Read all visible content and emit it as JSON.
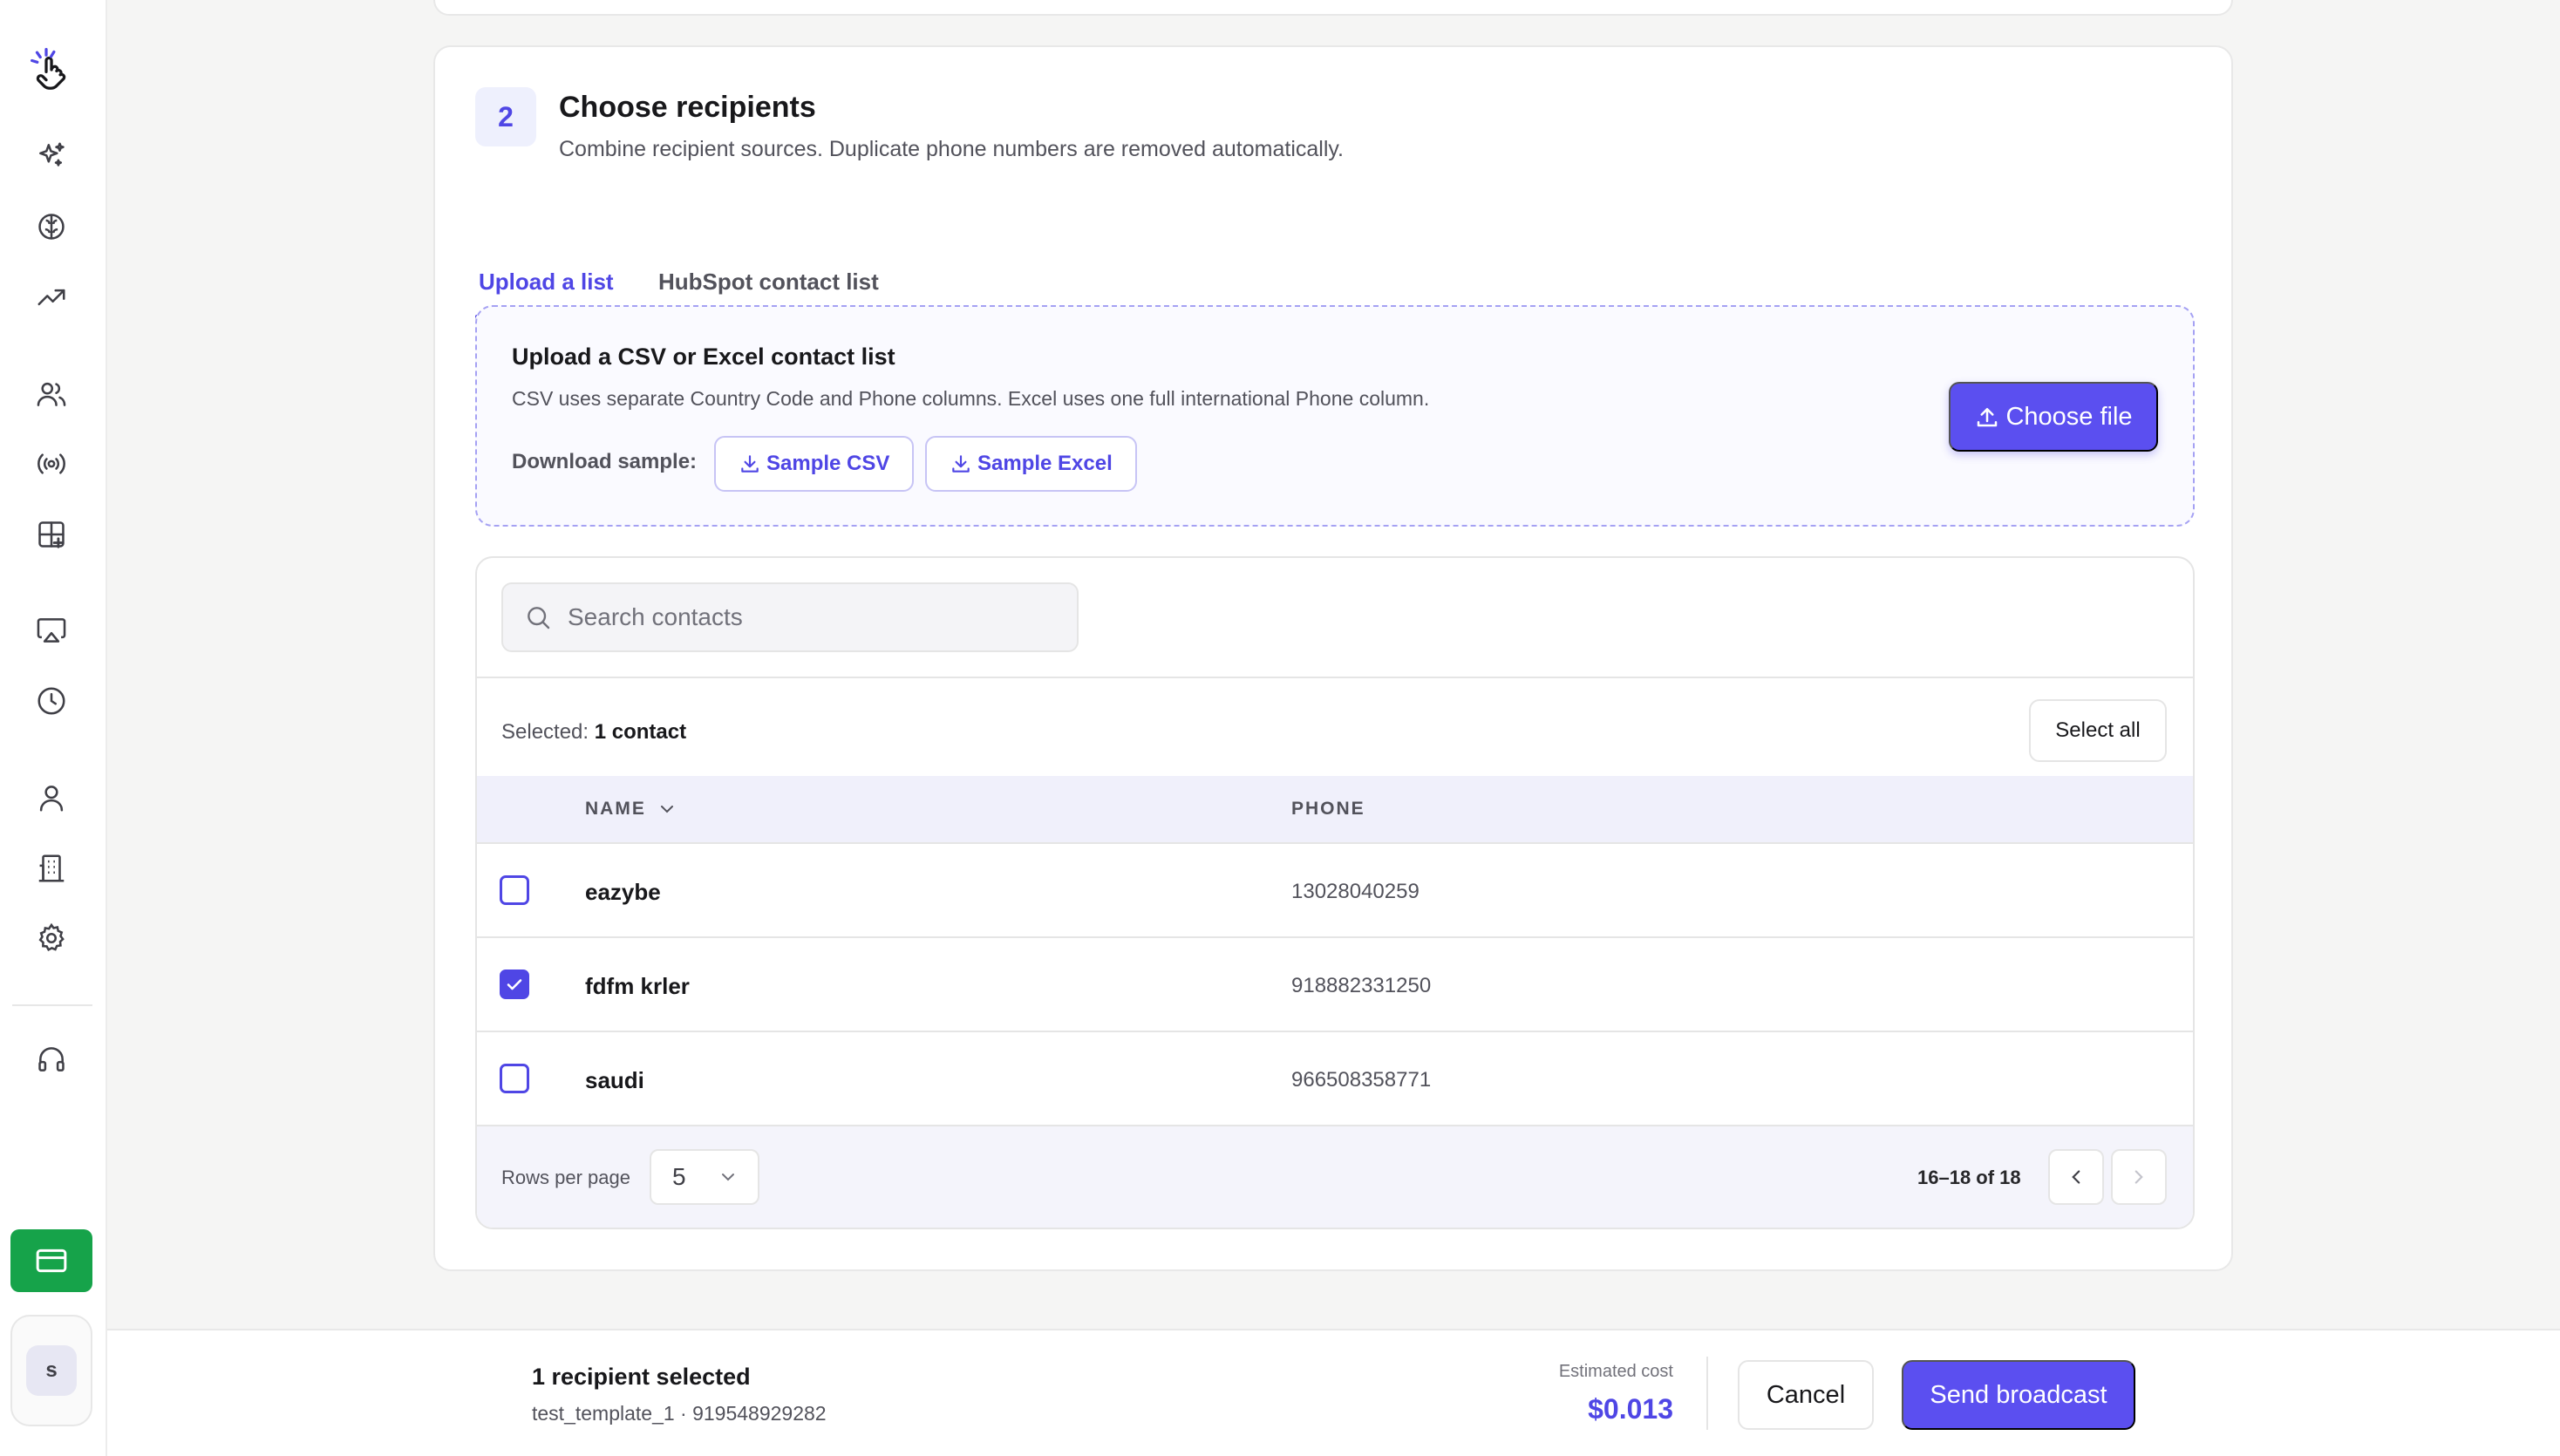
{
  "sidebar": {
    "logo_icon": "hand-pointer-sparkle-icon",
    "items": [
      {
        "icon": "sparkles-icon"
      },
      {
        "icon": "brain-icon"
      },
      {
        "icon": "trending-up-icon"
      },
      {
        "icon": "users-icon"
      },
      {
        "icon": "broadcast-icon"
      },
      {
        "icon": "grid-plus-icon"
      },
      {
        "icon": "monitor-icon"
      },
      {
        "icon": "clock-icon"
      },
      {
        "icon": "user-icon"
      },
      {
        "icon": "building-icon"
      },
      {
        "icon": "gear-icon"
      },
      {
        "icon": "headphones-icon"
      }
    ],
    "billing_icon": "credit-card-icon",
    "billing_color": "#16a34a",
    "user_initial": "s"
  },
  "step": {
    "number": "2",
    "title": "Choose recipients",
    "subtitle": "Combine recipient sources. Duplicate phone numbers are removed automatically."
  },
  "tabs": [
    {
      "label": "Upload a list",
      "active": true
    },
    {
      "label": "HubSpot contact list",
      "active": false
    }
  ],
  "upload": {
    "title": "Upload a CSV or Excel contact list",
    "description": "CSV uses separate Country Code and Phone columns. Excel uses one full international Phone column.",
    "download_label": "Download sample:",
    "sample_csv": "Sample CSV",
    "sample_excel": "Sample Excel",
    "choose_file": "Choose file"
  },
  "table": {
    "search_placeholder": "Search contacts",
    "selected_prefix": "Selected:",
    "selected_count": "1 contact",
    "select_all": "Select all",
    "columns": [
      "NAME",
      "PHONE"
    ],
    "rows": [
      {
        "name": "eazybe",
        "phone": "13028040259",
        "checked": false
      },
      {
        "name": "fdfm krler",
        "phone": "918882331250",
        "checked": true
      },
      {
        "name": "saudi",
        "phone": "966508358771",
        "checked": false
      }
    ],
    "rows_per_page_label": "Rows per page",
    "rows_per_page": "5",
    "range": "16–18 of 18"
  },
  "footer": {
    "title": "1 recipient selected",
    "subtitle": "test_template_1 · 919548929282",
    "cost_label": "Estimated cost",
    "cost_value": "$0.013",
    "cancel": "Cancel",
    "send": "Send broadcast"
  },
  "colors": {
    "accent": "#4f46e5",
    "accent_button": "#5b4ff0",
    "success": "#16a34a"
  }
}
